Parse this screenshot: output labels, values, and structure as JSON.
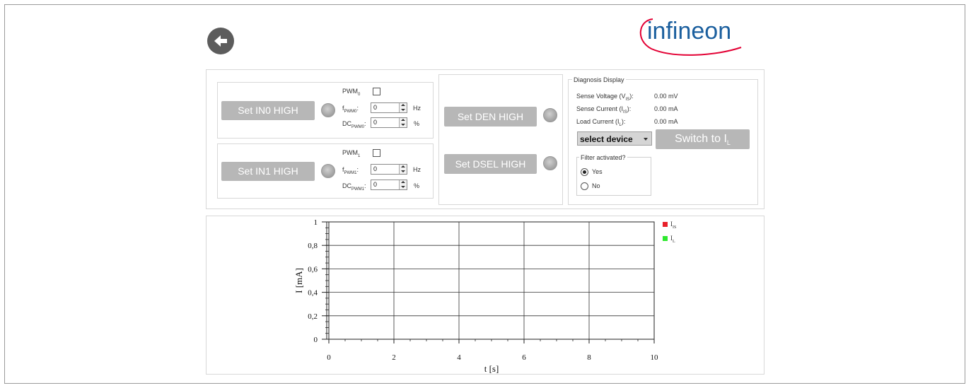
{
  "header": {
    "back_icon": "arrow-left-icon",
    "logo_text": "infineon",
    "logo_color": "#1b5f9e",
    "logo_arc_color": "#e30034"
  },
  "inputs": {
    "in0": {
      "button_label": "Set IN0 HIGH",
      "pwm_label": "PWM",
      "pwm_sub": "0",
      "pwm_checked": false,
      "freq_label": "f",
      "freq_sub": "PWM0",
      "freq_value": "0",
      "freq_unit": "Hz",
      "dc_label": "DC",
      "dc_sub": "PWM0",
      "dc_value": "0",
      "dc_unit": "%"
    },
    "in1": {
      "button_label": "Set IN1 HIGH",
      "pwm_label": "PWM",
      "pwm_sub": "1",
      "pwm_checked": false,
      "freq_label": "f",
      "freq_sub": "PWM1",
      "freq_value": "0",
      "freq_unit": "Hz",
      "dc_label": "DC",
      "dc_sub": "PWM1",
      "dc_value": "0",
      "dc_unit": "%"
    }
  },
  "den": {
    "den_button_label": "Set DEN HIGH",
    "dsel_button_label": "Set DSEL HIGH"
  },
  "diagnosis": {
    "title": "Diagnosis Display",
    "sense_voltage_label": "Sense Voltage (V",
    "sense_voltage_sub": "IS",
    "sense_voltage_value": "0.00 mV",
    "sense_current_label": "Sense Current (I",
    "sense_current_sub": "IS",
    "sense_current_value": "0.00 mA",
    "load_current_label": "Load Current (I",
    "load_current_sub": "L",
    "load_current_value": "0.00 mA",
    "device_select_value": "select device",
    "switch_button_label": "Switch to I",
    "switch_button_sub": "L",
    "filter_title": "Filter activated?",
    "filter_yes": "Yes",
    "filter_no": "No",
    "filter_selected": "Yes"
  },
  "chart_data": {
    "type": "line",
    "xlabel": "t [s]",
    "ylabel": "I [mA]",
    "xlim": [
      0,
      10
    ],
    "ylim": [
      0,
      1
    ],
    "x_ticks": [
      "0",
      "2",
      "4",
      "6",
      "8",
      "10"
    ],
    "y_ticks": [
      "0",
      "0,2",
      "0,4",
      "0,6",
      "0,8",
      "1"
    ],
    "grid": true,
    "legend_position": "right",
    "series": [
      {
        "name": "I",
        "name_sub": "IS",
        "color": "#e8202a",
        "x": [],
        "y": []
      },
      {
        "name": "I",
        "name_sub": "L",
        "color": "#2ee82e",
        "x": [],
        "y": []
      }
    ]
  }
}
